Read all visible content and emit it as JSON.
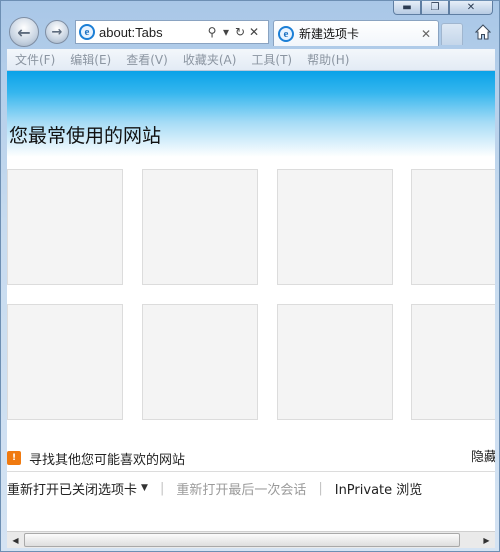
{
  "window": {
    "caption_buttons": {
      "minimize": "▬",
      "restore": "❐",
      "close": "✕"
    }
  },
  "nav": {
    "back_glyph": "←",
    "forward_glyph": "→",
    "address": {
      "value": "about:Tabs",
      "search_glyph": "⚲",
      "dropdown_glyph": "▾",
      "refresh_glyph": "↻",
      "stop_glyph": "✕"
    },
    "tab": {
      "title": "新建选项卡",
      "close_glyph": "✕"
    },
    "home_icon": "home-icon"
  },
  "menu": {
    "items": [
      "文件(F)",
      "编辑(E)",
      "查看(V)",
      "收藏夹(A)",
      "工具(T)",
      "帮助(H)"
    ]
  },
  "content": {
    "section_title": "您最常使用的网站",
    "find_sites_label": "寻找其他您可能喜欢的网站",
    "hide_label": "隐藏",
    "bottom_links": {
      "reopen_closed": "重新打开已关闭选项卡",
      "reopen_session": "重新打开最后一次会话",
      "inprivate": "InPrivate 浏览"
    }
  },
  "colors": {
    "banner_top": "#0aa2e8",
    "find_icon": "#f07a10",
    "tile_bg": "#f4f4f4",
    "disabled_text": "#9a9a9a"
  },
  "scrollbar": {
    "left_glyph": "◀",
    "right_glyph": "▶"
  }
}
